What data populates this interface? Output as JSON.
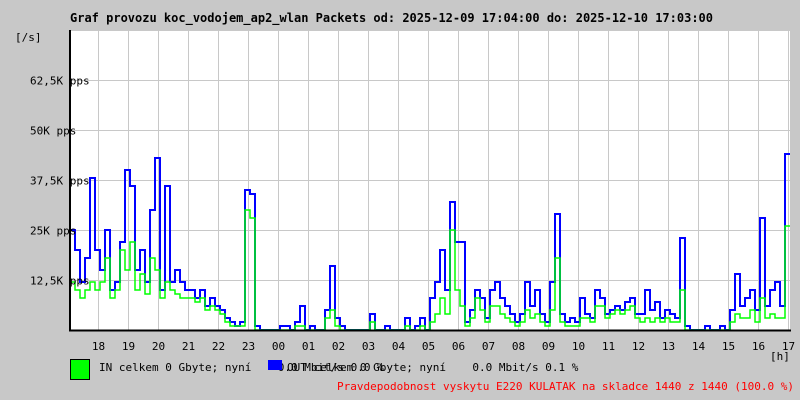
{
  "chart_data": {
    "type": "line",
    "title": "Graf provozu koc_vodojem_ap2_wlan Packets od: 2025-12-09 17:04:00 do: 2025-12-10 17:03:00",
    "ylabel": "[/s]",
    "xlabel": "[h]",
    "ylim": [
      0,
      75000
    ],
    "y_ticks": [
      {
        "value": 12500,
        "label": "12,5K pps"
      },
      {
        "value": 25000,
        "label": "25K pps"
      },
      {
        "value": 37500,
        "label": "37,5K pps"
      },
      {
        "value": 50000,
        "label": "50K pps"
      },
      {
        "value": 62500,
        "label": "62,5K pps"
      }
    ],
    "x_tick_labels": [
      "18",
      "19",
      "20",
      "21",
      "22",
      "23",
      "00",
      "01",
      "02",
      "03",
      "04",
      "05",
      "06",
      "07",
      "08",
      "09",
      "10",
      "11",
      "12",
      "13",
      "14",
      "15",
      "16",
      "17"
    ],
    "x_range_hours": [
      17.067,
      41.05
    ],
    "sample_interval_minutes": 10,
    "grid": true,
    "colors": {
      "in": "#00ff00",
      "out": "#0000ff",
      "grid": "#c8c8c8",
      "plot_bg": "#ffffff"
    },
    "series": [
      {
        "name": "IN",
        "unit": "K pps",
        "values": [
          12,
          10,
          8,
          10,
          12,
          10,
          12,
          18,
          8,
          10,
          20,
          15,
          22,
          10,
          14,
          9,
          18,
          15,
          8,
          12,
          10,
          9,
          8,
          8,
          8,
          7,
          8,
          5,
          6,
          5,
          4,
          2,
          1,
          1,
          1,
          30,
          28,
          0,
          0,
          0,
          0,
          0,
          0,
          0,
          0,
          1,
          1,
          0,
          0,
          0,
          0,
          3,
          5,
          1,
          0,
          0,
          0,
          0,
          0,
          0,
          2,
          0,
          0,
          0,
          0,
          0,
          0,
          1,
          0,
          0,
          1,
          0,
          2,
          4,
          8,
          4,
          25,
          10,
          6,
          1,
          3,
          8,
          5,
          2,
          6,
          6,
          4,
          3,
          2,
          1,
          2,
          5,
          3,
          4,
          2,
          1,
          5,
          18,
          2,
          1,
          1,
          1,
          3,
          3,
          2,
          6,
          6,
          3,
          4,
          5,
          4,
          5,
          6,
          3,
          2,
          3,
          2,
          3,
          2,
          3,
          2,
          2,
          10,
          0,
          0,
          0,
          0,
          0,
          0,
          0,
          0,
          0,
          2,
          4,
          3,
          3,
          5,
          2,
          8,
          3,
          4,
          3,
          3,
          26
        ]
      },
      {
        "name": "OUT",
        "unit": "K pps",
        "values": [
          25,
          20,
          12,
          18,
          38,
          20,
          15,
          25,
          10,
          12,
          22,
          40,
          36,
          15,
          20,
          12,
          30,
          43,
          10,
          36,
          12,
          15,
          12,
          10,
          10,
          8,
          10,
          6,
          8,
          6,
          5,
          3,
          2,
          1,
          2,
          35,
          34,
          1,
          0,
          0,
          0,
          0,
          1,
          1,
          0,
          2,
          6,
          0,
          1,
          0,
          0,
          5,
          16,
          3,
          1,
          0,
          0,
          0,
          0,
          0,
          4,
          0,
          0,
          1,
          0,
          0,
          0,
          3,
          0,
          1,
          3,
          0,
          8,
          12,
          20,
          10,
          32,
          22,
          22,
          2,
          5,
          10,
          8,
          3,
          10,
          12,
          8,
          6,
          4,
          2,
          4,
          12,
          6,
          10,
          4,
          2,
          12,
          29,
          4,
          2,
          3,
          2,
          8,
          4,
          3,
          10,
          8,
          4,
          5,
          6,
          5,
          7,
          8,
          4,
          4,
          10,
          5,
          7,
          3,
          5,
          4,
          3,
          23,
          1,
          0,
          0,
          0,
          1,
          0,
          0,
          1,
          0,
          5,
          14,
          6,
          8,
          10,
          5,
          28,
          6,
          10,
          12,
          6,
          44
        ]
      }
    ]
  },
  "legend": {
    "in_text": "IN celkem 0 Gbyte; nyní    0.0 Mbit/s 0.0 %",
    "out_text": "OUT celkem 0 Gbyte; nyní    0.0 Mbit/s 0.1 %",
    "note": "Pravdepodobnost vyskytu E220 KULATAK na skladce 1440 z 1440 (100.0 %)"
  }
}
